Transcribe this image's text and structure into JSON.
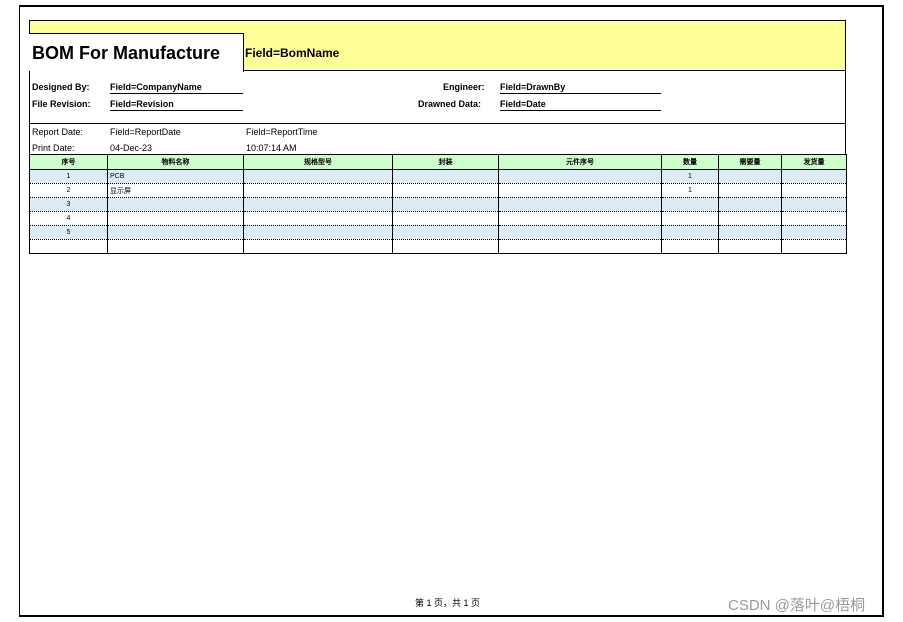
{
  "banner": {
    "title": "BOM For Manufacture",
    "bom_name": "Field=BomName"
  },
  "info": {
    "designed_by_label": "Designed By:",
    "designed_by_value": "Field=CompanyName",
    "file_revision_label": "File Revision:",
    "file_revision_value": "Field=Revision",
    "engineer_label": "Engineer:",
    "engineer_value": "Field=DrawnBy",
    "drawned_data_label": "Drawned Data:",
    "drawned_data_value": "Field=Date"
  },
  "dates": {
    "report_date_label": "Report Date:",
    "report_date_value": "Field=ReportDate",
    "report_time_value": "Field=ReportTime",
    "print_date_label": "Print Date:",
    "print_date_value": "04-Dec-23",
    "print_time_value": "10:07:14 AM"
  },
  "table": {
    "headers": [
      "序号",
      "物料名称",
      "规格型号",
      "封装",
      "元件序号",
      "数量",
      "需要量",
      "发货量"
    ],
    "rows": [
      [
        "1",
        "PCB",
        "",
        "",
        "",
        "1",
        "",
        ""
      ],
      [
        "2",
        "显示屏",
        "",
        "",
        "",
        "1",
        "",
        ""
      ],
      [
        "3",
        "",
        "",
        "",
        "",
        "",
        "",
        ""
      ],
      [
        "4",
        "",
        "",
        "",
        "",
        "",
        "",
        ""
      ],
      [
        "5",
        "",
        "",
        "",
        "",
        "",
        "",
        ""
      ],
      [
        "",
        "",
        "",
        "",
        "",
        "",
        "",
        ""
      ]
    ]
  },
  "footer": {
    "page_text": "第 1 页，共 1 页"
  },
  "watermark": "CSDN @落叶@梧桐",
  "colors": {
    "banner": "#ffff99",
    "header": "#ccffcc",
    "row_shade": "#ddebf7"
  }
}
